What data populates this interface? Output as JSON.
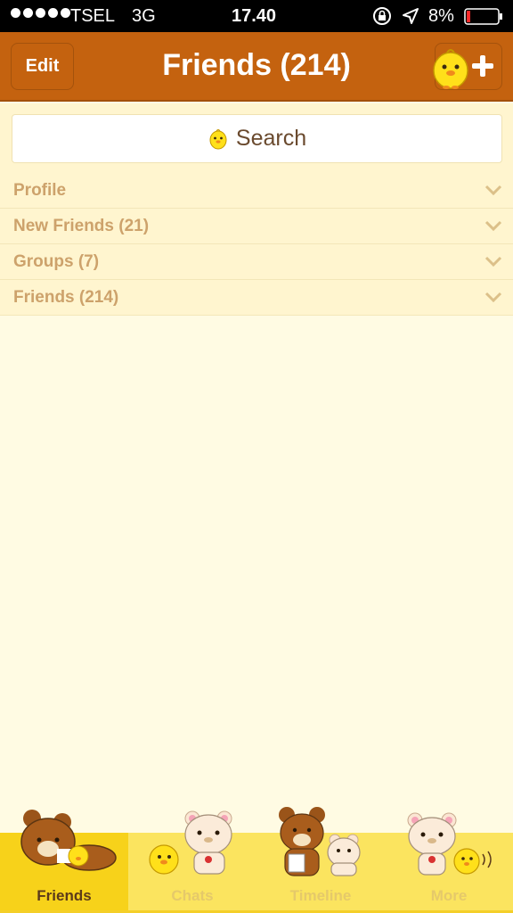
{
  "status_bar": {
    "carrier": "TSEL",
    "network": "3G",
    "time": "17.40",
    "battery": "8%"
  },
  "nav": {
    "edit_label": "Edit",
    "title": "Friends (214)"
  },
  "search": {
    "placeholder": "Search"
  },
  "sections": [
    {
      "label": "Profile"
    },
    {
      "label": "New Friends (21)"
    },
    {
      "label": "Groups (7)"
    },
    {
      "label": "Friends (214)"
    }
  ],
  "tabs": [
    {
      "label": "Friends",
      "active": true
    },
    {
      "label": "Chats",
      "active": false
    },
    {
      "label": "Timeline",
      "active": false
    },
    {
      "label": "More",
      "active": false
    }
  ],
  "colors": {
    "nav_bar": "#c4620f",
    "background": "#fffbe3",
    "tab_bar": "#fbe45f",
    "tab_active": "#f7d21a",
    "section_text": "#cda26b"
  },
  "icons": {
    "lock": "rotation-lock-icon",
    "location": "location-arrow-icon",
    "battery": "battery-icon",
    "add_friend": "chick-plus-icon",
    "search": "chick-icon",
    "chevron": "chevron-down-icon"
  }
}
